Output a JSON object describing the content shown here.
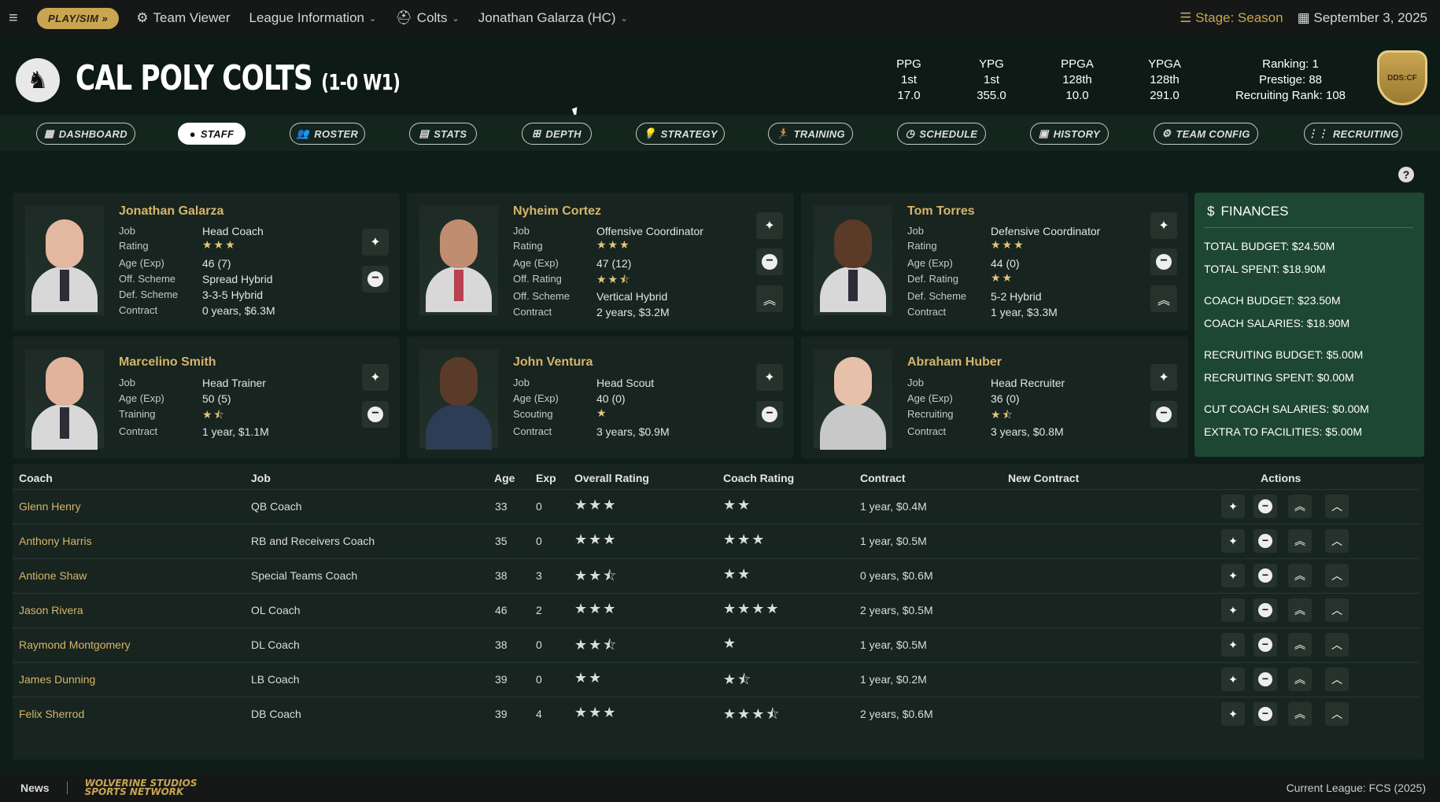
{
  "topbar": {
    "play_sim": "PLAY/SIM",
    "team_viewer": "Team Viewer",
    "league_info": "League Information",
    "team_select": "Colts",
    "coach_select": "Jonathan Galarza (HC)",
    "stage": "Stage: Season",
    "date": "September 3, 2025"
  },
  "header": {
    "team_name": "CAL POLY COLTS",
    "record": "(1-0 W1)",
    "stats": [
      {
        "label": "PPG",
        "rank": "1st",
        "value": "17.0"
      },
      {
        "label": "YPG",
        "rank": "1st",
        "value": "355.0"
      },
      {
        "label": "PPGA",
        "rank": "128th",
        "value": "10.0"
      },
      {
        "label": "YPGA",
        "rank": "128th",
        "value": "291.0"
      }
    ],
    "ranking": "Ranking: 1",
    "prestige": "Prestige: 88",
    "recruiting_rank": "Recruiting Rank: 108",
    "shield_text": "DDS:CF"
  },
  "tabs": [
    "DASHBOARD",
    "STAFF",
    "ROSTER",
    "STATS",
    "DEPTH",
    "STRATEGY",
    "TRAINING",
    "SCHEDULE",
    "HISTORY",
    "TEAM CONFIG",
    "RECRUITING"
  ],
  "staff": [
    {
      "name": "Jonathan Galarza",
      "fields": [
        [
          "Job",
          "Head Coach"
        ],
        [
          "Rating",
          "★★★"
        ],
        [
          "Age (Exp)",
          "46 (7)"
        ],
        [
          "Off. Scheme",
          "Spread Hybrid"
        ],
        [
          "Def. Scheme",
          "3-3-5 Hybrid"
        ],
        [
          "Contract",
          "0 years, $6.3M"
        ]
      ]
    },
    {
      "name": "Nyheim Cortez",
      "fields": [
        [
          "Job",
          "Offensive Coordinator"
        ],
        [
          "Rating",
          "★★★"
        ],
        [
          "Age (Exp)",
          "47 (12)"
        ],
        [
          "Off. Rating",
          "★★⯪"
        ],
        [
          "Off. Scheme",
          "Vertical Hybrid"
        ],
        [
          "Contract",
          "2 years, $3.2M"
        ]
      ]
    },
    {
      "name": "Tom Torres",
      "fields": [
        [
          "Job",
          "Defensive Coordinator"
        ],
        [
          "Rating",
          "★★★"
        ],
        [
          "Age (Exp)",
          "44 (0)"
        ],
        [
          "Def. Rating",
          "★★"
        ],
        [
          "Def. Scheme",
          "5-2 Hybrid"
        ],
        [
          "Contract",
          "1 year, $3.3M"
        ]
      ]
    },
    {
      "name": "Marcelino Smith",
      "fields": [
        [
          "Job",
          "Head Trainer"
        ],
        [
          "Age (Exp)",
          "50 (5)"
        ],
        [
          "Training",
          "★⯪"
        ],
        [
          "Contract",
          "1 year, $1.1M"
        ]
      ]
    },
    {
      "name": "John Ventura",
      "fields": [
        [
          "Job",
          "Head Scout"
        ],
        [
          "Age (Exp)",
          "40 (0)"
        ],
        [
          "Scouting",
          "★"
        ],
        [
          "Contract",
          "3 years, $0.9M"
        ]
      ]
    },
    {
      "name": "Abraham Huber",
      "fields": [
        [
          "Job",
          "Head Recruiter"
        ],
        [
          "Age (Exp)",
          "36 (0)"
        ],
        [
          "Recruiting",
          "★⯪"
        ],
        [
          "Contract",
          "3 years, $0.8M"
        ]
      ]
    }
  ],
  "finances": {
    "title": "FINANCES",
    "rows": [
      "TOTAL BUDGET: $24.50M",
      "TOTAL SPENT: $18.90M",
      "COACH BUDGET: $23.50M",
      "COACH SALARIES: $18.90M",
      "RECRUITING BUDGET: $5.00M",
      "RECRUITING SPENT: $0.00M",
      "CUT COACH SALARIES: $0.00M",
      "EXTRA TO FACILITIES: $5.00M"
    ]
  },
  "table": {
    "headers": [
      "Coach",
      "Job",
      "Age",
      "Exp",
      "Overall Rating",
      "Coach Rating",
      "Contract",
      "New Contract",
      "Actions"
    ],
    "rows": [
      [
        "Glenn Henry",
        "QB Coach",
        "33",
        "0",
        "★★★",
        "★★",
        "1 year, $0.4M"
      ],
      [
        "Anthony Harris",
        "RB and Receivers Coach",
        "35",
        "0",
        "★★★",
        "★★★",
        "1 year, $0.5M"
      ],
      [
        "Antione Shaw",
        "Special Teams Coach",
        "38",
        "3",
        "★★⯪",
        "★★",
        "0 years, $0.6M"
      ],
      [
        "Jason Rivera",
        "OL Coach",
        "46",
        "2",
        "★★★",
        "★★★★",
        "2 years, $0.5M"
      ],
      [
        "Raymond Montgomery",
        "DL Coach",
        "38",
        "0",
        "★★⯪",
        "★",
        "1 year, $0.5M"
      ],
      [
        "James Dunning",
        "LB Coach",
        "39",
        "0",
        "★★",
        "★⯪",
        "1 year, $0.2M"
      ],
      [
        "Felix Sherrod",
        "DB Coach",
        "39",
        "4",
        "★★★",
        "★★★⯪",
        "2 years, $0.6M"
      ]
    ]
  },
  "footer": {
    "news": "News",
    "brand_line1": "WOLVERINE STUDIOS",
    "brand_line2": "SPORTS NETWORK",
    "league": "Current League: FCS (2025)"
  }
}
